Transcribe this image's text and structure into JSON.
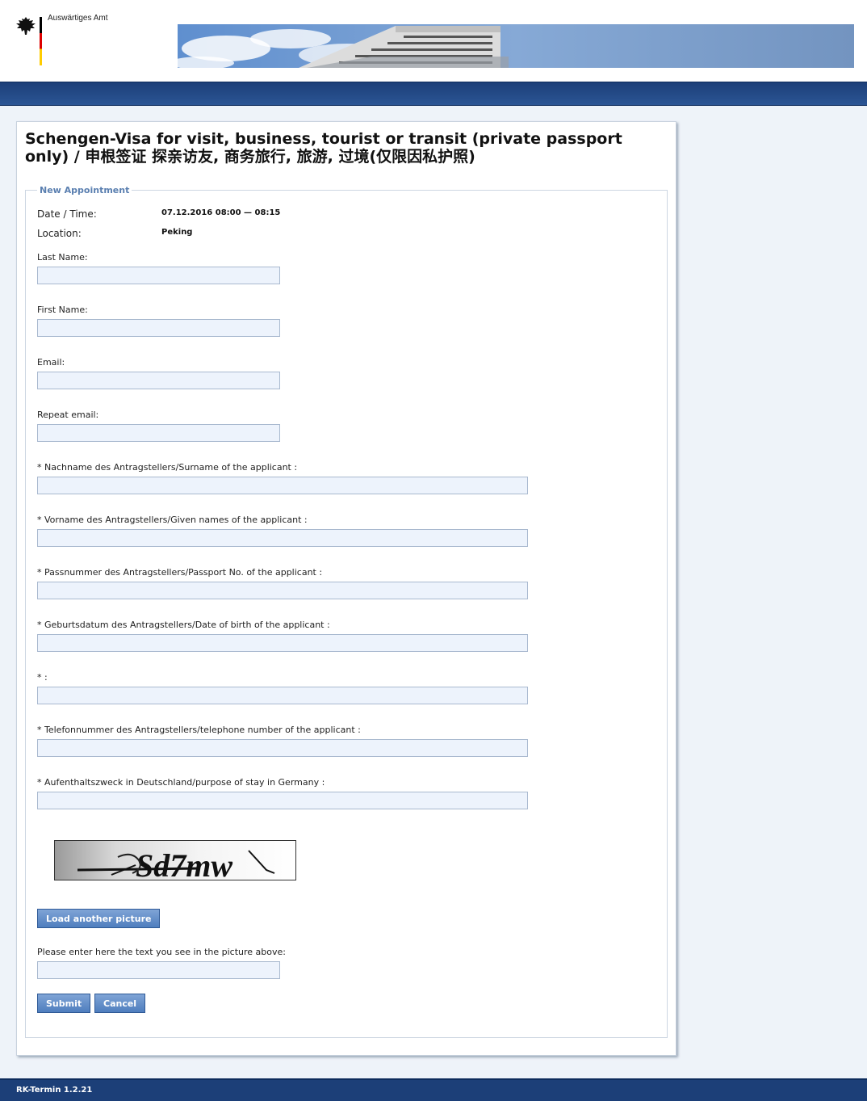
{
  "header": {
    "org_name": "Auswärtiges Amt"
  },
  "page": {
    "title": "Schengen-Visa for visit, business, tourist or transit (private passport only) / 申根签证 探亲访友, 商务旅行, 旅游, 过境(仅限因私护照)"
  },
  "form": {
    "legend": "New Appointment",
    "datetime_label": "Date / Time:",
    "datetime_value": "07.12.2016 08:00 — 08:15",
    "location_label": "Location:",
    "location_value": "Peking",
    "last_name_label": "Last Name:",
    "first_name_label": "First Name:",
    "email_label": "Email:",
    "repeat_email_label": "Repeat email:",
    "surname_label": "* Nachname des Antragstellers/Surname of the applicant :",
    "given_names_label": "* Vorname des Antragstellers/Given names of the applicant :",
    "passport_label": "* Passnummer des Antragstellers/Passport No. of the applicant :",
    "dob_label": "* Geburtsdatum des Antragstellers/Date of birth of the applicant :",
    "empty_label": "* :",
    "phone_label": "* Telefonnummer des Antragstellers/telephone number of the applicant :",
    "purpose_label": "* Aufenthaltszweck in Deutschland/purpose of stay in Germany :",
    "captcha_text": "Sd7mw",
    "load_picture_button": "Load another picture",
    "captcha_prompt": "Please enter here the text you see in the picture above:",
    "submit_button": "Submit",
    "cancel_button": "Cancel"
  },
  "footer": {
    "version": "RK-Termin 1.2.21"
  }
}
